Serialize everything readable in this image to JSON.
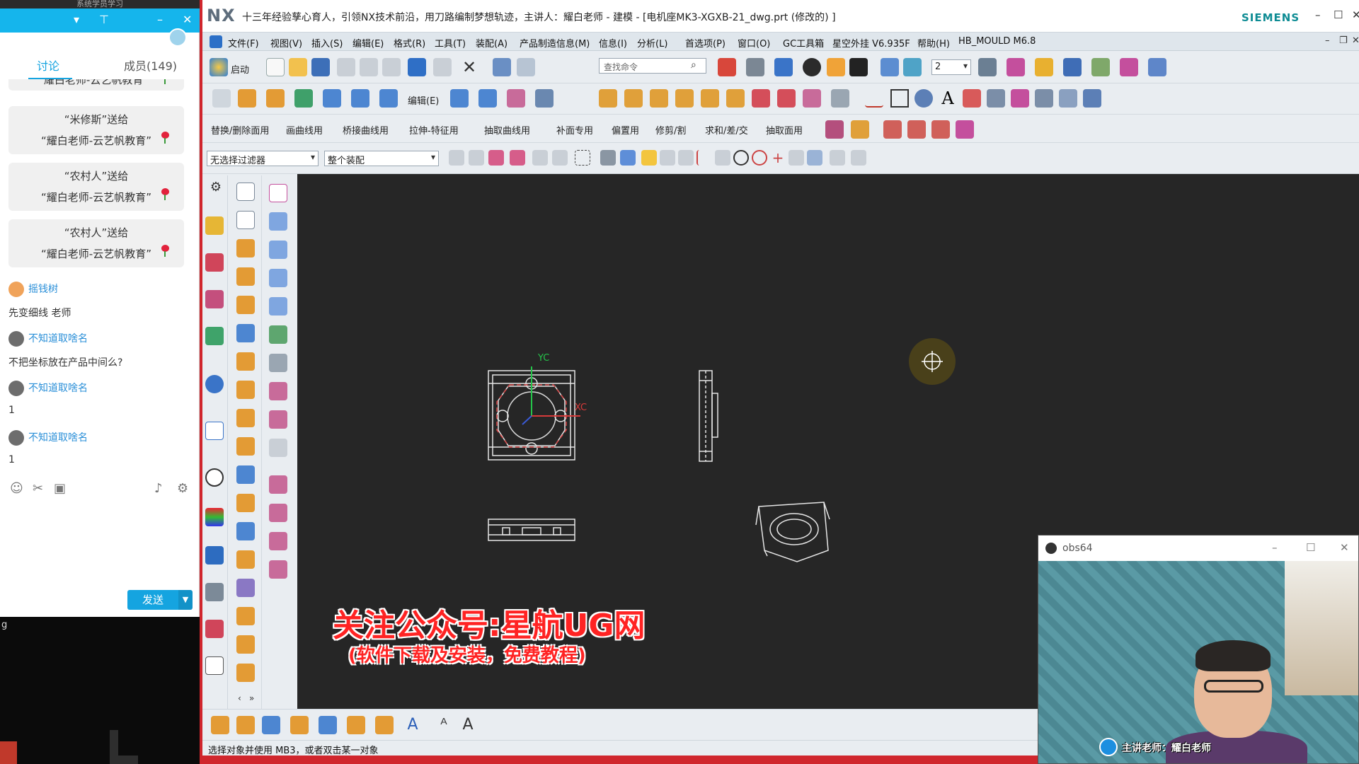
{
  "chat": {
    "top_text": "系统学员学习",
    "tabs": {
      "discuss": "讨论",
      "members": "成员(149)"
    },
    "gift_partial": "耀白老师-云艺帆教育”",
    "gifts": [
      {
        "line1": "“米修斯”送给",
        "line2": "“耀白老师-云艺帆教育”"
      },
      {
        "line1": "“农村人”送给",
        "line2": "“耀白老师-云艺帆教育”"
      },
      {
        "line1": "“农村人”送给",
        "line2": "“耀白老师-云艺帆教育”"
      }
    ],
    "messages": [
      {
        "user": "摇钱树",
        "text": "先变细线  老师"
      },
      {
        "user": "不知道取啥名",
        "text": "不把坐标放在产品中间么?"
      },
      {
        "user": "不知道取啥名",
        "text": "1"
      },
      {
        "user": "不知道取啥名",
        "text": "1"
      }
    ],
    "send_label": "发送",
    "bottom_text": "g"
  },
  "nx": {
    "logo": "NX",
    "title": "十三年经验孳心育人，引领NX技术前沿，用刀路编制梦想轨迹，主讲人：耀白老师 - 建模 - [电机座MK3-XGXB-21_dwg.prt  (修改的) ]",
    "brand": "SIEMENS",
    "menus": [
      "文件(F)",
      "视图(V)",
      "插入(S)",
      "编辑(E)",
      "格式(R)",
      "工具(T)",
      "装配(A)",
      "产品制造信息(M)",
      "信息(I)",
      "分析(L)",
      "首选项(P)",
      "窗口(O)",
      "GC工具箱",
      "星空外挂 V6.935F",
      "帮助(H)",
      "HB_MOULD M6.8"
    ],
    "toolbar1": {
      "start_label": "启动",
      "search_placeholder": "查找命令",
      "layer_value": "2"
    },
    "toolbar2": {
      "edit_label": "编辑(E)"
    },
    "toolbar3": [
      "替换/删除面用",
      "画曲线用",
      "桥接曲线用",
      "拉伸-特征用",
      "抽取曲线用",
      "补面专用",
      "偏置用",
      "修剪/割",
      "求和/差/交",
      "抽取面用"
    ],
    "filters": {
      "type_filter": "无选择过滤器",
      "scope": "整个装配"
    },
    "status": "选择对象并使用 MB3，或者双击某一对象",
    "axis_labels": {
      "yc": "YC",
      "xc": "XC"
    }
  },
  "banner": {
    "line1": "关注公众号:星航UG网",
    "line2": "(软件下载及安装，免费教程)"
  },
  "obs": {
    "title": "obs64",
    "caption": "主讲老师：耀白老师"
  },
  "colors": {
    "chat_accent": "#15a4e0",
    "nx_frame": "#d0262d",
    "graphics_bg": "#262626",
    "siemens": "#0e8c94",
    "banner_red": "#ff2323"
  }
}
